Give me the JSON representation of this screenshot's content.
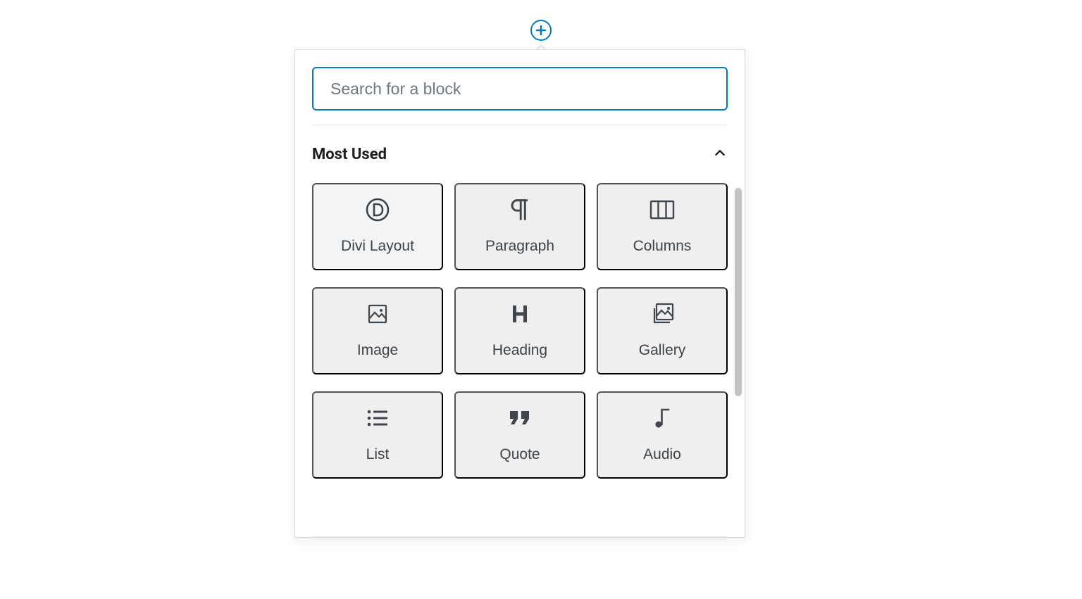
{
  "colors": {
    "accent": "#007cba"
  },
  "search": {
    "placeholder": "Search for a block",
    "value": ""
  },
  "section": {
    "title": "Most Used",
    "expanded": true
  },
  "blocks": [
    {
      "label": "Divi Layout",
      "icon": "divi-icon",
      "hovered": true
    },
    {
      "label": "Paragraph",
      "icon": "paragraph-icon",
      "hovered": false
    },
    {
      "label": "Columns",
      "icon": "columns-icon",
      "hovered": false
    },
    {
      "label": "Image",
      "icon": "image-icon",
      "hovered": false
    },
    {
      "label": "Heading",
      "icon": "heading-icon",
      "hovered": false
    },
    {
      "label": "Gallery",
      "icon": "gallery-icon",
      "hovered": false
    },
    {
      "label": "List",
      "icon": "list-icon",
      "hovered": false
    },
    {
      "label": "Quote",
      "icon": "quote-icon",
      "hovered": false
    },
    {
      "label": "Audio",
      "icon": "audio-icon",
      "hovered": false
    }
  ]
}
